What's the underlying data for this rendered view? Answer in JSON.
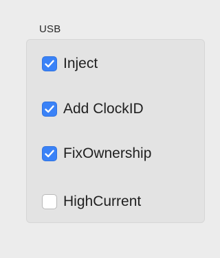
{
  "usb_group": {
    "title": "USB",
    "options": [
      {
        "label": "Inject",
        "checked": true
      },
      {
        "label": "Add ClockID",
        "checked": true
      },
      {
        "label": "FixOwnership",
        "checked": true
      },
      {
        "label": "HighCurrent",
        "checked": false
      }
    ]
  },
  "colors": {
    "checkbox_checked": "#3a82f7",
    "checkbox_unchecked": "#ffffff",
    "window_background": "#ececec"
  },
  "icons": {
    "checked": "checkmark-icon"
  }
}
